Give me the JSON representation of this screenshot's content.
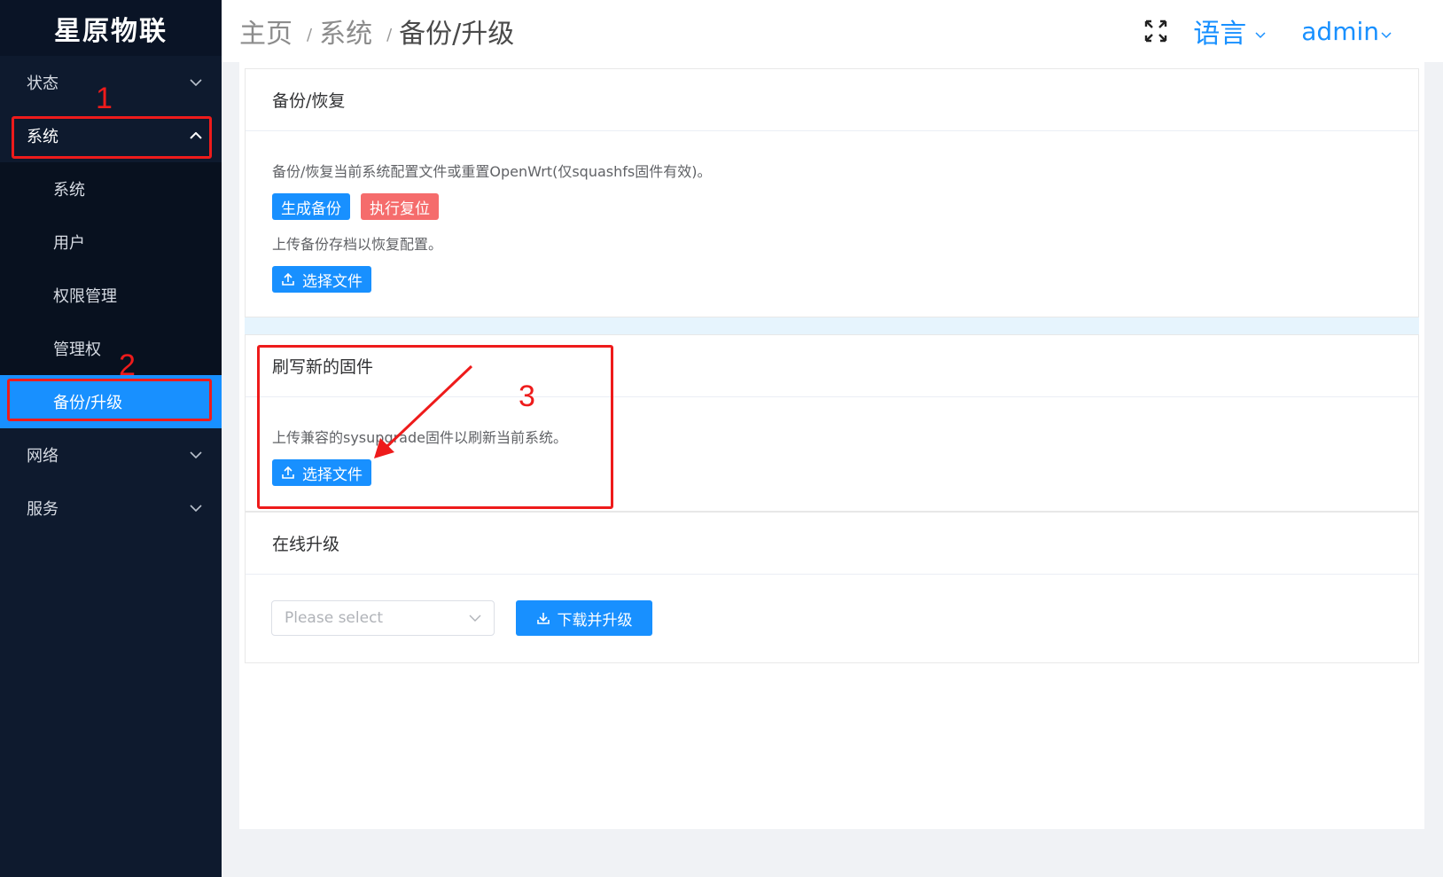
{
  "brand": {
    "name": "星原物联"
  },
  "sidebar": {
    "menus": [
      {
        "label": "状态"
      },
      {
        "label": "系统"
      },
      {
        "label": "网络"
      },
      {
        "label": "服务"
      }
    ],
    "submenu": [
      {
        "label": "系统"
      },
      {
        "label": "用户"
      },
      {
        "label": "权限管理"
      },
      {
        "label": "管理权"
      },
      {
        "label": "备份/升级"
      }
    ]
  },
  "header": {
    "breadcrumb": [
      "主页",
      "系统",
      "备份/升级"
    ],
    "separator": "/",
    "language": "语言",
    "user": "admin"
  },
  "backup_card": {
    "title": "备份/恢复",
    "description": "备份/恢复当前系统配置文件或重置OpenWrt(仅squashfs固件有效)。",
    "generate_button": "生成备份",
    "reset_button": "执行复位",
    "upload_text": "上传备份存档以恢复配置。",
    "choose_file_button": "选择文件"
  },
  "flash_card": {
    "title": "刷写新的固件",
    "description": "上传兼容的sysupgrade固件以刷新当前系统。",
    "choose_file_button": "选择文件"
  },
  "online_card": {
    "title": "在线升级",
    "select_placeholder": "Please select",
    "download_button": "下载并升级"
  },
  "annotations": [
    "1",
    "2",
    "3"
  ],
  "colors": {
    "sidebar": "#0e1a2e",
    "primary": "#1890ff",
    "danger": "#f56c6c",
    "annotation": "#ee1b1b"
  }
}
